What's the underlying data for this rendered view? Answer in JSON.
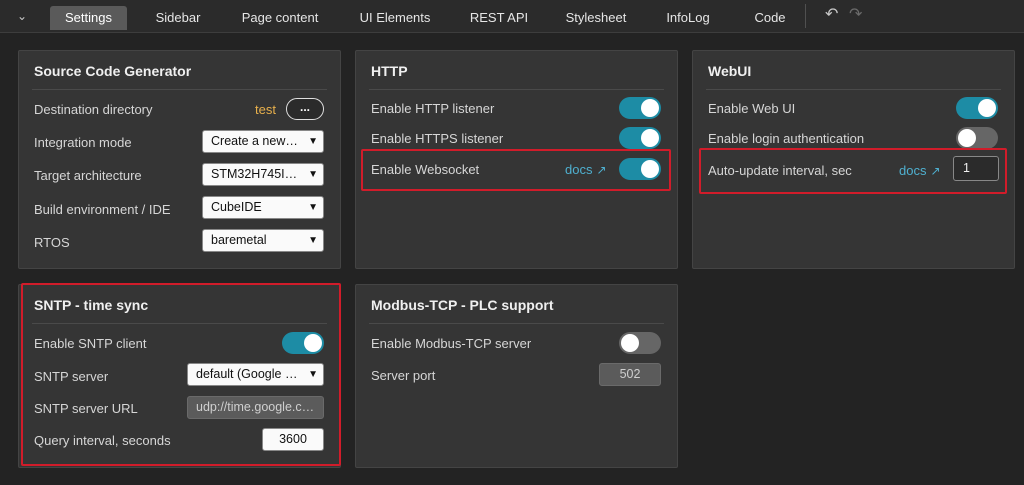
{
  "tabs": [
    {
      "label": "Settings",
      "active": true
    },
    {
      "label": "Sidebar"
    },
    {
      "label": "Page content"
    },
    {
      "label": "UI Elements"
    },
    {
      "label": "REST API"
    },
    {
      "label": "Stylesheet"
    },
    {
      "label": "InfoLog"
    },
    {
      "label": "Code"
    }
  ],
  "icons": {
    "collapse": "chevron-down-icon",
    "undo": "undo-icon",
    "redo": "redo-icon",
    "external": "external-link-icon"
  },
  "colors": {
    "toggle_on": "#1d8ca5",
    "link": "#4fb0d0",
    "highlight": "#d11c2a",
    "accent": "#e8b04c"
  },
  "source_code_generator": {
    "title": "Source Code Generator",
    "destination_label": "Destination directory",
    "destination_value": "test",
    "browse_label": "...",
    "integration_label": "Integration mode",
    "integration_value": "Create a new…",
    "target_label": "Target architecture",
    "target_value": "STM32H745I…",
    "build_label": "Build environment / IDE",
    "build_value": "CubeIDE",
    "rtos_label": "RTOS",
    "rtos_value": "baremetal"
  },
  "http": {
    "title": "HTTP",
    "http_listener_label": "Enable HTTP listener",
    "http_listener_on": true,
    "https_listener_label": "Enable HTTPS listener",
    "https_listener_on": true,
    "websocket_label": "Enable Websocket",
    "websocket_docs": "docs",
    "websocket_on": true
  },
  "webui": {
    "title": "WebUI",
    "web_ui_label": "Enable Web UI",
    "web_ui_on": true,
    "login_auth_label": "Enable login authentication",
    "login_auth_on": false,
    "auto_update_label": "Auto-update interval, sec",
    "auto_update_docs": "docs",
    "auto_update_value": "1"
  },
  "sntp": {
    "title": "SNTP - time sync",
    "client_label": "Enable SNTP client",
    "client_on": true,
    "server_label": "SNTP server",
    "server_value": "default (Google …",
    "url_label": "SNTP server URL",
    "url_value": "udp://time.google.c…",
    "interval_label": "Query interval, seconds",
    "interval_value": "3600"
  },
  "modbus": {
    "title": "Modbus-TCP - PLC support",
    "server_label": "Enable Modbus-TCP server",
    "server_on": false,
    "port_label": "Server port",
    "port_value": "502"
  }
}
